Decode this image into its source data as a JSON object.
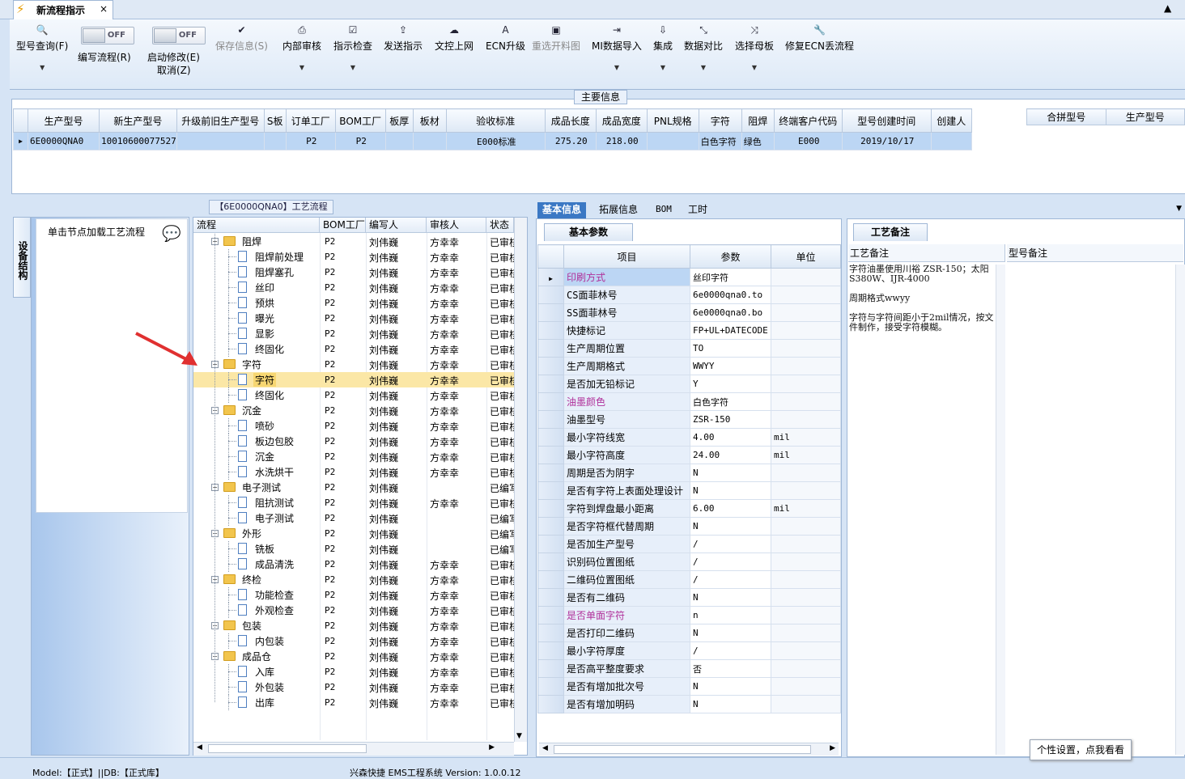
{
  "tab": {
    "title": "新流程指示",
    "close": "×"
  },
  "toolbar": {
    "query": "型号查询(F)",
    "toggle1_state": "OFF",
    "toggle1_label": "编写流程(R)",
    "toggle2_state": "OFF",
    "toggle2_label": "启动修改(E)",
    "toggle2_sub": "取消(Z)",
    "save": "保存信息(S)",
    "internal_review": "内部审核",
    "check": "指示检查",
    "send": "发送指示",
    "doc_upload": "文控上网",
    "ecn": "ECN升级",
    "reselect": "重选开料图",
    "mi_import": "MI数据导入",
    "integrate": "集成",
    "compare": "数据对比",
    "select_mother": "选择母板",
    "fix_ecn": "修复ECN丢流程"
  },
  "main": {
    "label": "主要信息",
    "columns": [
      "生产型号",
      "新生产型号",
      "升级前旧生产型号",
      "S板",
      "订单工厂",
      "BOM工厂",
      "板厚",
      "板材",
      "验收标准",
      "成品长度",
      "成品宽度",
      "PNL规格",
      "字符",
      "阻焊",
      "终端客户代码",
      "型号创建时间",
      "创建人"
    ],
    "row": [
      "6E0000QNA0",
      "10010600077527",
      "",
      "",
      "P2",
      "P2",
      "",
      "",
      "E000标准",
      "275.20",
      "218.00",
      "",
      "白色字符",
      "绿色",
      "E000",
      "2019/10/17",
      ""
    ],
    "side_columns": [
      "合拼型号",
      "生产型号"
    ]
  },
  "left": {
    "strip": "设备结构",
    "hint": "单击节点加载工艺流程"
  },
  "flow": {
    "label": "【6E0000QNA0】工艺流程",
    "columns": [
      "流程",
      "BOM工厂",
      "编写人",
      "审核人",
      "状态"
    ],
    "rows": [
      {
        "name": "阻焊",
        "type": "folder",
        "bom": "P2",
        "writer": "刘伟巍",
        "reviewer": "方幸幸",
        "status": "已审核"
      },
      {
        "name": "阻焊前处理",
        "type": "doc",
        "bom": "P2",
        "writer": "刘伟巍",
        "reviewer": "方幸幸",
        "status": "已审核"
      },
      {
        "name": "阻焊塞孔",
        "type": "doc",
        "bom": "P2",
        "writer": "刘伟巍",
        "reviewer": "方幸幸",
        "status": "已审核"
      },
      {
        "name": "丝印",
        "type": "doc",
        "bom": "P2",
        "writer": "刘伟巍",
        "reviewer": "方幸幸",
        "status": "已审核"
      },
      {
        "name": "预烘",
        "type": "doc",
        "bom": "P2",
        "writer": "刘伟巍",
        "reviewer": "方幸幸",
        "status": "已审核"
      },
      {
        "name": "曝光",
        "type": "doc",
        "bom": "P2",
        "writer": "刘伟巍",
        "reviewer": "方幸幸",
        "status": "已审核"
      },
      {
        "name": "显影",
        "type": "doc",
        "bom": "P2",
        "writer": "刘伟巍",
        "reviewer": "方幸幸",
        "status": "已审核"
      },
      {
        "name": "终固化",
        "type": "doc",
        "bom": "P2",
        "writer": "刘伟巍",
        "reviewer": "方幸幸",
        "status": "已审核"
      },
      {
        "name": "字符",
        "type": "folder",
        "bom": "P2",
        "writer": "刘伟巍",
        "reviewer": "方幸幸",
        "status": "已审核"
      },
      {
        "name": "字符",
        "type": "doc",
        "bom": "P2",
        "writer": "刘伟巍",
        "reviewer": "方幸幸",
        "status": "已审核",
        "selected": true
      },
      {
        "name": "终固化",
        "type": "doc",
        "bom": "P2",
        "writer": "刘伟巍",
        "reviewer": "方幸幸",
        "status": "已审核"
      },
      {
        "name": "沉金",
        "type": "folder",
        "bom": "P2",
        "writer": "刘伟巍",
        "reviewer": "方幸幸",
        "status": "已审核"
      },
      {
        "name": "喷砂",
        "type": "doc",
        "bom": "P2",
        "writer": "刘伟巍",
        "reviewer": "方幸幸",
        "status": "已审核"
      },
      {
        "name": "板边包胶",
        "type": "doc",
        "bom": "P2",
        "writer": "刘伟巍",
        "reviewer": "方幸幸",
        "status": "已审核"
      },
      {
        "name": "沉金",
        "type": "doc",
        "bom": "P2",
        "writer": "刘伟巍",
        "reviewer": "方幸幸",
        "status": "已审核"
      },
      {
        "name": "水洗烘干",
        "type": "doc",
        "bom": "P2",
        "writer": "刘伟巍",
        "reviewer": "方幸幸",
        "status": "已审核"
      },
      {
        "name": "电子测试",
        "type": "folder",
        "bom": "P2",
        "writer": "刘伟巍",
        "reviewer": "",
        "status": "已编写"
      },
      {
        "name": "阻抗测试",
        "type": "doc",
        "bom": "P2",
        "writer": "刘伟巍",
        "reviewer": "方幸幸",
        "status": "已审核"
      },
      {
        "name": "电子测试",
        "type": "doc",
        "bom": "P2",
        "writer": "刘伟巍",
        "reviewer": "",
        "status": "已编写"
      },
      {
        "name": "外形",
        "type": "folder",
        "bom": "P2",
        "writer": "刘伟巍",
        "reviewer": "",
        "status": "已编写"
      },
      {
        "name": "铣板",
        "type": "doc",
        "bom": "P2",
        "writer": "刘伟巍",
        "reviewer": "",
        "status": "已编写"
      },
      {
        "name": "成品清洗",
        "type": "doc",
        "bom": "P2",
        "writer": "刘伟巍",
        "reviewer": "方幸幸",
        "status": "已审核"
      },
      {
        "name": "终检",
        "type": "folder",
        "bom": "P2",
        "writer": "刘伟巍",
        "reviewer": "方幸幸",
        "status": "已审核"
      },
      {
        "name": "功能检查",
        "type": "doc",
        "bom": "P2",
        "writer": "刘伟巍",
        "reviewer": "方幸幸",
        "status": "已审核"
      },
      {
        "name": "外观检查",
        "type": "doc",
        "bom": "P2",
        "writer": "刘伟巍",
        "reviewer": "方幸幸",
        "status": "已审核"
      },
      {
        "name": "包装",
        "type": "folder",
        "bom": "P2",
        "writer": "刘伟巍",
        "reviewer": "方幸幸",
        "status": "已审核"
      },
      {
        "name": "内包装",
        "type": "doc",
        "bom": "P2",
        "writer": "刘伟巍",
        "reviewer": "方幸幸",
        "status": "已审核"
      },
      {
        "name": "成品仓",
        "type": "folder",
        "bom": "P2",
        "writer": "刘伟巍",
        "reviewer": "方幸幸",
        "status": "已审核"
      },
      {
        "name": "入库",
        "type": "doc",
        "bom": "P2",
        "writer": "刘伟巍",
        "reviewer": "方幸幸",
        "status": "已审核"
      },
      {
        "name": "外包装",
        "type": "doc",
        "bom": "P2",
        "writer": "刘伟巍",
        "reviewer": "方幸幸",
        "status": "已审核"
      },
      {
        "name": "出库",
        "type": "doc",
        "bom": "P2",
        "writer": "刘伟巍",
        "reviewer": "方幸幸",
        "status": "已审核"
      }
    ]
  },
  "mid": {
    "tabs": [
      "基本信息",
      "拓展信息",
      "BOM",
      "工时"
    ],
    "subtab": "基本参数",
    "columns": [
      "项目",
      "参数",
      "单位"
    ],
    "rows": [
      {
        "item": "印刷方式",
        "param": "丝印字符",
        "unit": "",
        "hl": true
      },
      {
        "item": "CS面菲林号",
        "param": "6e0000qna0.to",
        "unit": ""
      },
      {
        "item": "SS面菲林号",
        "param": "6e0000qna0.bo",
        "unit": ""
      },
      {
        "item": "快捷标记",
        "param": "FP+UL+DATECODE",
        "unit": ""
      },
      {
        "item": "生产周期位置",
        "param": "TO",
        "unit": ""
      },
      {
        "item": "生产周期格式",
        "param": "WWYY",
        "unit": ""
      },
      {
        "item": "是否加无铅标记",
        "param": "Y",
        "unit": ""
      },
      {
        "item": "油墨颜色",
        "param": "白色字符",
        "unit": "",
        "hl": true
      },
      {
        "item": "油墨型号",
        "param": "ZSR-150",
        "unit": ""
      },
      {
        "item": "最小字符线宽",
        "param": "4.00",
        "unit": "mil"
      },
      {
        "item": "最小字符高度",
        "param": "24.00",
        "unit": "mil"
      },
      {
        "item": "周期是否为阴字",
        "param": "N",
        "unit": ""
      },
      {
        "item": "是否有字符上表面处理设计",
        "param": "N",
        "unit": ""
      },
      {
        "item": "字符到焊盘最小距离",
        "param": "6.00",
        "unit": "mil"
      },
      {
        "item": "是否字符框代替周期",
        "param": "N",
        "unit": ""
      },
      {
        "item": "是否加生产型号",
        "param": "/",
        "unit": ""
      },
      {
        "item": "识别码位置图纸",
        "param": "/",
        "unit": ""
      },
      {
        "item": "二维码位置图纸",
        "param": "/",
        "unit": ""
      },
      {
        "item": "是否有二维码",
        "param": "N",
        "unit": ""
      },
      {
        "item": "是否单面字符",
        "param": "n",
        "unit": "",
        "hl": true
      },
      {
        "item": "是否打印二维码",
        "param": "N",
        "unit": ""
      },
      {
        "item": "最小字符厚度",
        "param": "/",
        "unit": ""
      },
      {
        "item": "是否高平整度要求",
        "param": "否",
        "unit": ""
      },
      {
        "item": "是否有增加批次号",
        "param": "N",
        "unit": ""
      },
      {
        "item": "是否有增加明码",
        "param": "N",
        "unit": ""
      }
    ]
  },
  "right": {
    "tab": "工艺备注",
    "col1": "工艺备注",
    "col2": "型号备注",
    "note1": "字符油墨使用川裕 ZSR-150；太阳S380W、IJR-4000",
    "note2": "周期格式wwyy",
    "note3": "字符与字符间距小于2mil情况，按文件制作，接受字符模糊。"
  },
  "status": {
    "left": "Model:【正式】||DB:【正式库】",
    "center": "兴森快捷 EMS工程系统 Version: 1.0.0.12",
    "tooltip": "个性设置，点我看看"
  },
  "colors": {
    "accent": "#3b78c4",
    "highlight_text": "#b0309a",
    "selection": "#fbe7a6",
    "arrow": "#e03030"
  }
}
